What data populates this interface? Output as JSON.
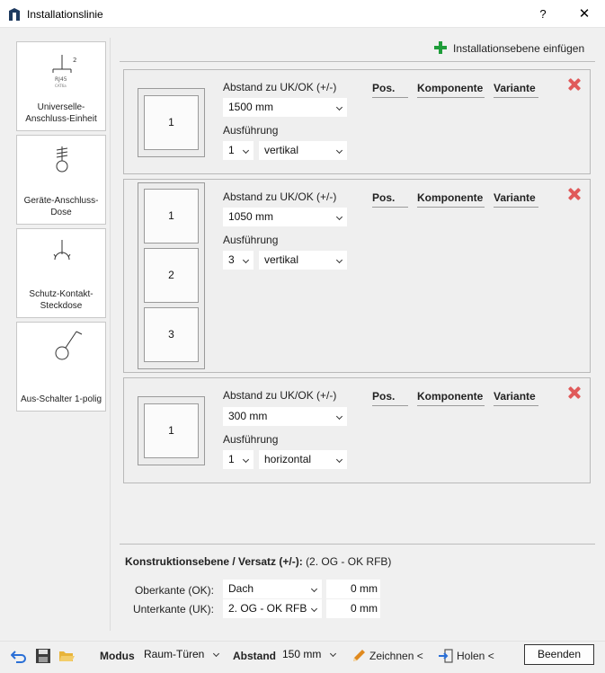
{
  "window": {
    "title": "Installationslinie",
    "help_label": "?",
    "close_label": "✕"
  },
  "toolbox": [
    {
      "label": "Universelle-Anschluss-Einheit",
      "icon": "rj45-outlet-icon",
      "icon_text": "RJ45",
      "icon_sub": "CAT6a",
      "icon_sup": "2"
    },
    {
      "label": "Geräte-Anschluss-Dose",
      "icon": "device-outlet-icon"
    },
    {
      "label": "Schutz-Kontakt-Steckdose",
      "icon": "socket-icon"
    },
    {
      "label": "Aus-Schalter 1-polig",
      "icon": "switch-icon"
    }
  ],
  "add_plane_label": "Installationsebene einfügen",
  "columns": {
    "pos": "Pos.",
    "komponente": "Komponente",
    "variante": "Variante"
  },
  "levels": [
    {
      "abstand_label": "Abstand zu UK/OK (+/-)",
      "abstand": "1500 mm",
      "ausfuehrung_label": "Ausführung",
      "count": "1",
      "orientation": "vertikal",
      "cells": [
        "1"
      ]
    },
    {
      "abstand_label": "Abstand zu UK/OK (+/-)",
      "abstand": "1050 mm",
      "ausfuehrung_label": "Ausführung",
      "count": "3",
      "orientation": "vertikal",
      "cells": [
        "1",
        "2",
        "3"
      ]
    },
    {
      "abstand_label": "Abstand zu UK/OK (+/-)",
      "abstand": "300 mm",
      "ausfuehrung_label": "Ausführung",
      "count": "1",
      "orientation": "horizontal",
      "cells": [
        "1"
      ]
    }
  ],
  "konstruktion": {
    "label": "Konstruktionsebene / Versatz (+/-):",
    "value": "(2. OG - OK RFB)",
    "oberkante_label": "Oberkante (OK):",
    "oberkante": "Dach",
    "oberkante_offset": "0 mm",
    "unterkante_label": "Unterkante (UK):",
    "unterkante": "2. OG - OK RFB",
    "unterkante_offset": "0 mm"
  },
  "footer": {
    "modus_label": "Modus",
    "modus": "Raum-Türen",
    "abstand_label": "Abstand",
    "abstand": "150 mm",
    "zeichnen_label": "Zeichnen <",
    "holen_label": "Holen <",
    "beenden_label": "Beenden"
  },
  "colors": {
    "accent_green": "#1f9d3a",
    "delete_red": "#e05a5a",
    "undo_blue": "#2a6fd6",
    "folder_yellow": "#e8b43a",
    "pencil_orange": "#e08a1e"
  }
}
